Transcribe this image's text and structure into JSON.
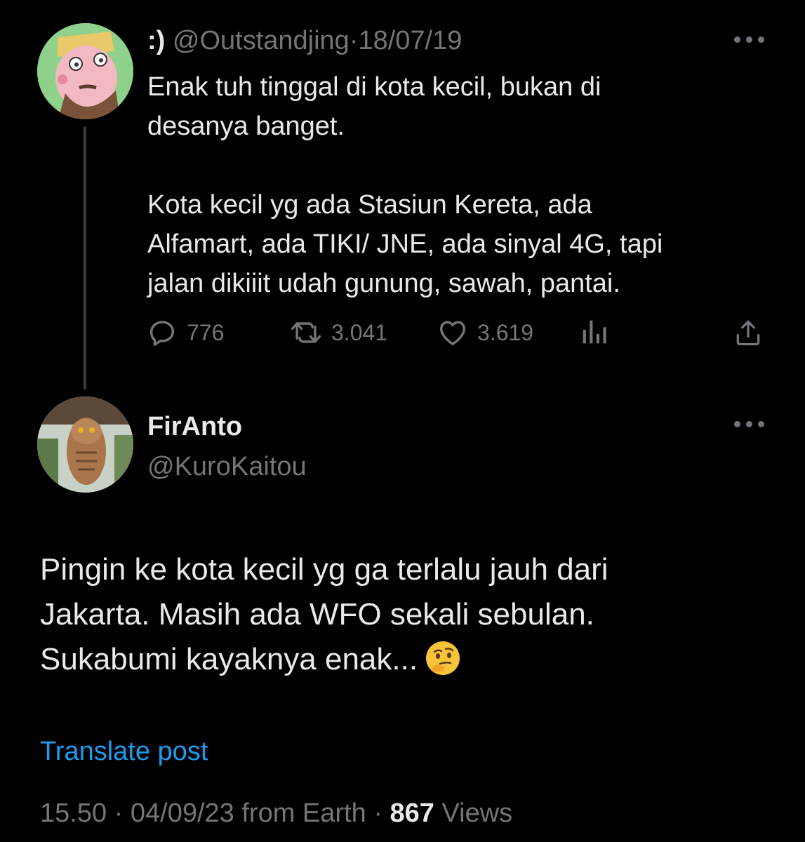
{
  "parent_tweet": {
    "display_name": ":)",
    "handle": "@Outstandjing",
    "separator": "·",
    "date": "18/07/19",
    "text_line1": "Enak tuh tinggal di kota kecil, bukan di",
    "text_line2": "desanya banget.",
    "text_line3": "Kota kecil yg ada Stasiun Kereta, ada",
    "text_line4": "Alfamart, ada TIKI/ JNE, ada sinyal 4G, tapi",
    "text_line5": "jalan dikiiit udah gunung, sawah, pantai.",
    "replies": "776",
    "retweets": "3.041",
    "likes": "3.619",
    "icons": [
      "reply-icon",
      "retweet-icon",
      "like-icon",
      "views-icon",
      "share-icon",
      "more-icon"
    ]
  },
  "reply_tweet": {
    "display_name": "FirAnto",
    "handle": "@KuroKaitou",
    "text_line1": "Pingin ke kota kecil yg ga terlalu jauh dari",
    "text_line2": "Jakarta. Masih ada WFO sekali sebulan.",
    "text_line3": "Sukabumi kayaknya enak...",
    "emoji": "thinking-face",
    "translate_label": "Translate post",
    "time": "15.50",
    "separator": "·",
    "date": "04/09/23",
    "source": "from Earth",
    "views_count": "867",
    "views_label": "Views"
  },
  "colors": {
    "background": "#000000",
    "text_primary": "#e7e9ea",
    "text_muted": "#71767b",
    "link": "#1d9bf0",
    "thread_line": "#3a3d41"
  }
}
